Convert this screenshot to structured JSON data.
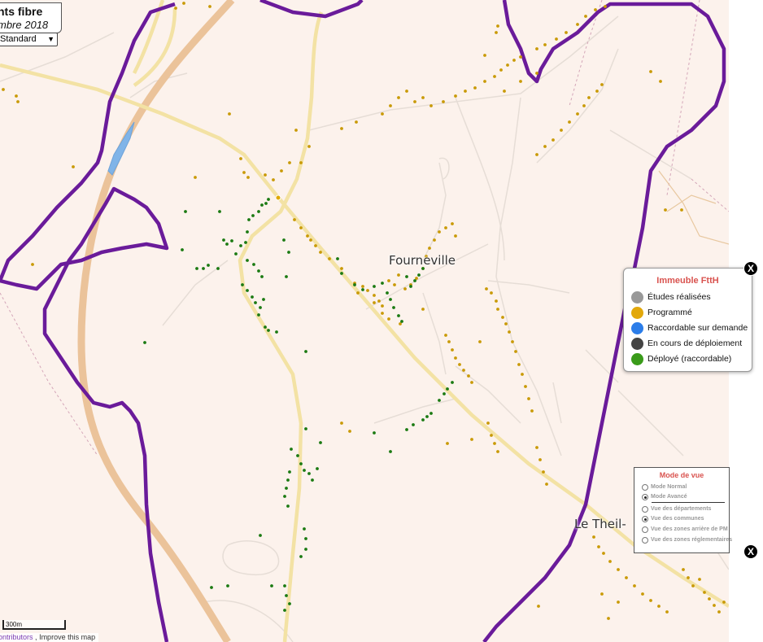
{
  "header": {
    "title_fragment": "nts fibre",
    "date_fragment": "mbre 2018",
    "selector_value": "Standard"
  },
  "places": {
    "town1": "Fourneville",
    "town2": "Le Theil-"
  },
  "legend_ftth": {
    "title": "Immeuble FttH",
    "items": [
      {
        "label": "Études réalisées",
        "color": "#999999"
      },
      {
        "label": "Programmé",
        "color": "#e2a80b"
      },
      {
        "label": "Raccordable sur demande",
        "color": "#2b7de9"
      },
      {
        "label": "En cours de déploiement",
        "color": "#444444"
      },
      {
        "label": "Déployé (raccordable)",
        "color": "#3a9b1a"
      }
    ],
    "close_label": "X"
  },
  "view_mode": {
    "title": "Mode de vue",
    "options": [
      {
        "label": "Mode Normal",
        "selected": false
      },
      {
        "label": "Mode Avancé",
        "selected": true
      },
      {
        "label": "Vue des départements",
        "selected": false
      },
      {
        "label": "Vue des communes",
        "selected": true
      },
      {
        "label": "Vue des zones arrière de PM",
        "selected": false
      },
      {
        "label": "Vue des zones réglementaires",
        "selected": false
      }
    ],
    "close_label": "X"
  },
  "scale": "300m",
  "attribution": {
    "contributors": "ontributors",
    "improve": "Improve this map"
  },
  "colors": {
    "background": "#fcf2ec",
    "boundary": "#6a1b9a",
    "main_road": "#f2dfa0",
    "highway": "#ecc295",
    "water": "#7fb3e6",
    "dot_programme": "#c99a07",
    "dot_deploye": "#1b7a12"
  }
}
